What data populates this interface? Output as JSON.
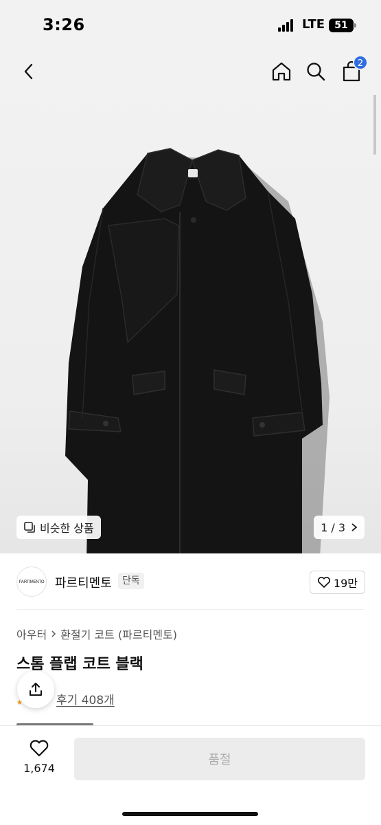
{
  "status_bar": {
    "time": "3:26",
    "network": "LTE",
    "battery": "51"
  },
  "nav": {
    "back_icon": "chevron-left-icon",
    "home_icon": "home-icon",
    "search_icon": "search-icon",
    "cart_icon": "shopping-bag-icon",
    "cart_badge": "2",
    "badge_color": "#2f6de1"
  },
  "gallery": {
    "similar_label": "비슷한 상품",
    "page_indicator": "1 / 3"
  },
  "brand": {
    "logo_text": "PARTIMENTO",
    "name": "파르티멘토",
    "exclusive_badge": "단독",
    "likes": "19만"
  },
  "product": {
    "breadcrumb": [
      "아우터",
      "환절기 코트 (파르티멘토)"
    ],
    "title": "스톰 플랩 코트 블랙",
    "reviews": "후기 408개"
  },
  "bottom_bar": {
    "like_count": "1,674",
    "soldout_label": "품절"
  }
}
